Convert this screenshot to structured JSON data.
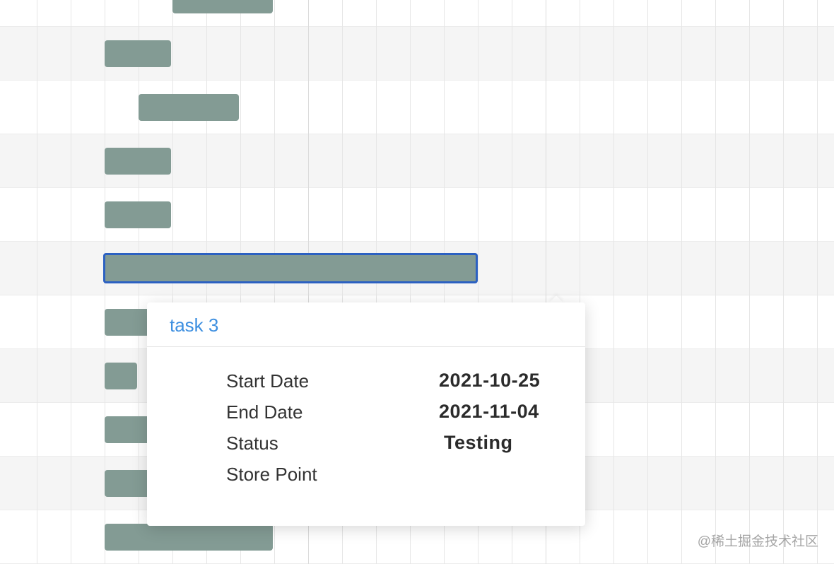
{
  "tooltip": {
    "title": "task 3",
    "fields": [
      {
        "label": "Start Date",
        "value": "2021-10-25"
      },
      {
        "label": "End Date",
        "value": "2021-11-04"
      },
      {
        "label": "Status",
        "value": "Testing"
      },
      {
        "label": "Store Point",
        "value": ""
      }
    ]
  },
  "watermark": "@稀土掘金技术社区",
  "colors": {
    "bar": "#839b94",
    "selected_border": "#2c61c2",
    "tooltip_title": "#3d8fe0",
    "row_alt": "#f5f5f5"
  }
}
